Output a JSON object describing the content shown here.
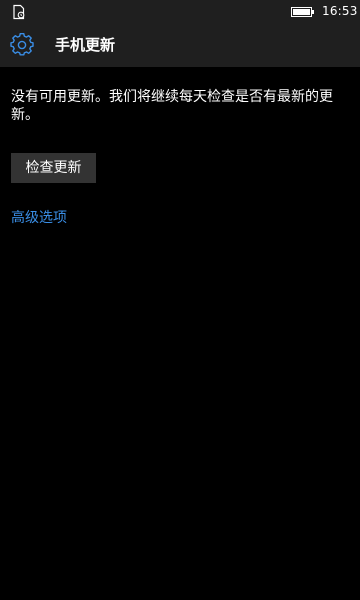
{
  "status_bar": {
    "left_icon": "notification-device-icon",
    "battery_icon": "battery-icon",
    "time": "16:53"
  },
  "header": {
    "icon": "gear-icon",
    "title": "手机更新"
  },
  "main": {
    "message": "没有可用更新。我们将继续每天检查是否有最新的更新。",
    "check_button_label": "检查更新",
    "advanced_link_label": "高级选项"
  },
  "colors": {
    "background": "#000000",
    "bar_background": "#1f1f1f",
    "accent": "#3a8ee6",
    "button_background": "#333333",
    "text": "#ffffff"
  }
}
